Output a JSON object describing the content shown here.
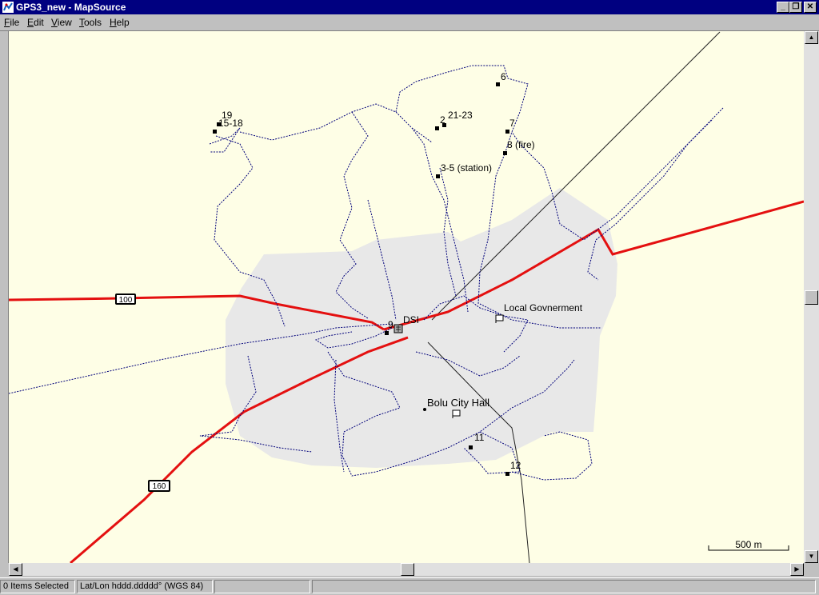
{
  "window": {
    "title": "GPS3_new - MapSource"
  },
  "menu": {
    "items": [
      {
        "acc": "F",
        "rest": "ile"
      },
      {
        "acc": "E",
        "rest": "dit"
      },
      {
        "acc": "V",
        "rest": "iew"
      },
      {
        "acc": "T",
        "rest": "ools"
      },
      {
        "acc": "H",
        "rest": "elp"
      }
    ]
  },
  "map": {
    "waypoints": {
      "w6": "6",
      "w7": "7",
      "w8": "8 (fire)",
      "w19": "19",
      "w1518": "15-18",
      "w2": "2",
      "w2123": "21-23",
      "w35": "3-5 (station)",
      "w9": "9",
      "w11": "11",
      "w12": "12"
    },
    "places": {
      "dsi": "DSI",
      "gov": "Local Govnerment",
      "cityhall": "Bolu City Hall"
    },
    "shields": {
      "r100": "100",
      "r160": "160"
    },
    "scale": "500 m",
    "colors": {
      "background": "#fefee6",
      "urban": "#e8e8e8",
      "highway": "#e41010",
      "track": "#00007a"
    }
  },
  "status": {
    "selected": "0 Items Selected",
    "coords": "Lat/Lon hddd.ddddd° (WGS 84)"
  }
}
